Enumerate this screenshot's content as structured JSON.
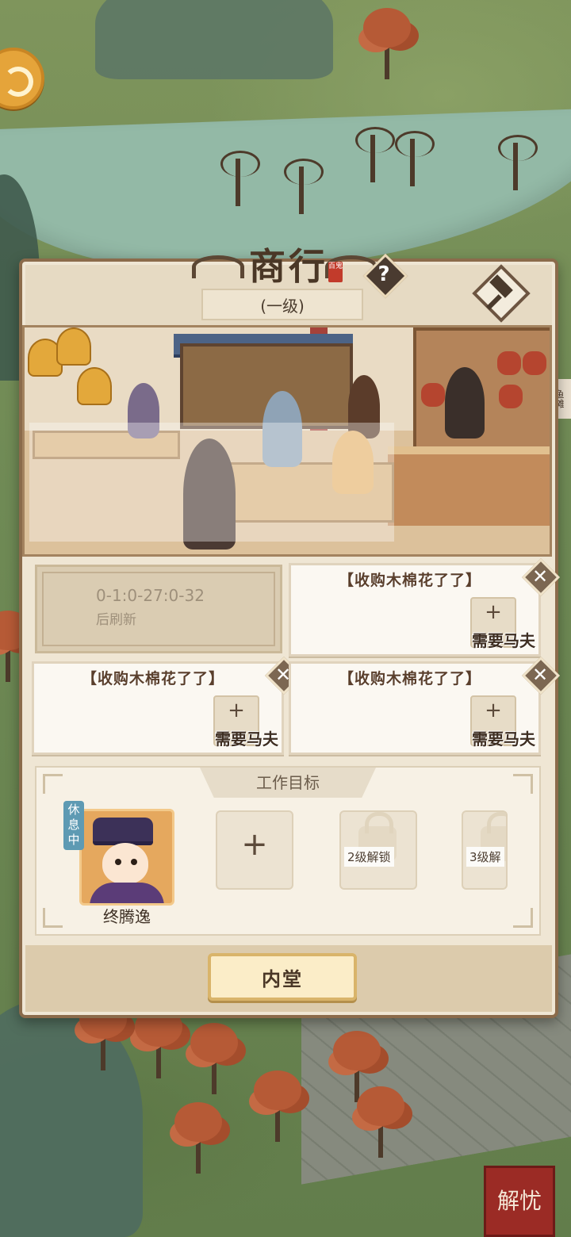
{
  "side_tag": "鱼摊",
  "relieve_button": "解忧",
  "panel": {
    "title": "商行",
    "seal": "百鬼",
    "level": "(一级)"
  },
  "orders": {
    "timer_line1": "0-1:0-27:0-32",
    "timer_line2": "后刷新",
    "slots": [
      {
        "title": "【收购木棉花了了】",
        "need": "需要马夫"
      },
      {
        "title": "【收购木棉花了了】",
        "need": "需要马夫"
      },
      {
        "title": "【收购木棉花了了】",
        "need": "需要马夫"
      }
    ]
  },
  "work": {
    "title": "工作目标",
    "character": {
      "name": "终腾逸",
      "status": "休息中"
    },
    "add_label": "+",
    "locks": [
      {
        "label": "2级解锁"
      },
      {
        "label": "3级解"
      }
    ]
  },
  "footer": {
    "button": "内堂"
  },
  "colors": {
    "panel_bg": "#efe6d4",
    "panel_border": "#8b6b4b",
    "status_badge": "#5e9ab3",
    "relieve_red": "#9b2b25"
  }
}
